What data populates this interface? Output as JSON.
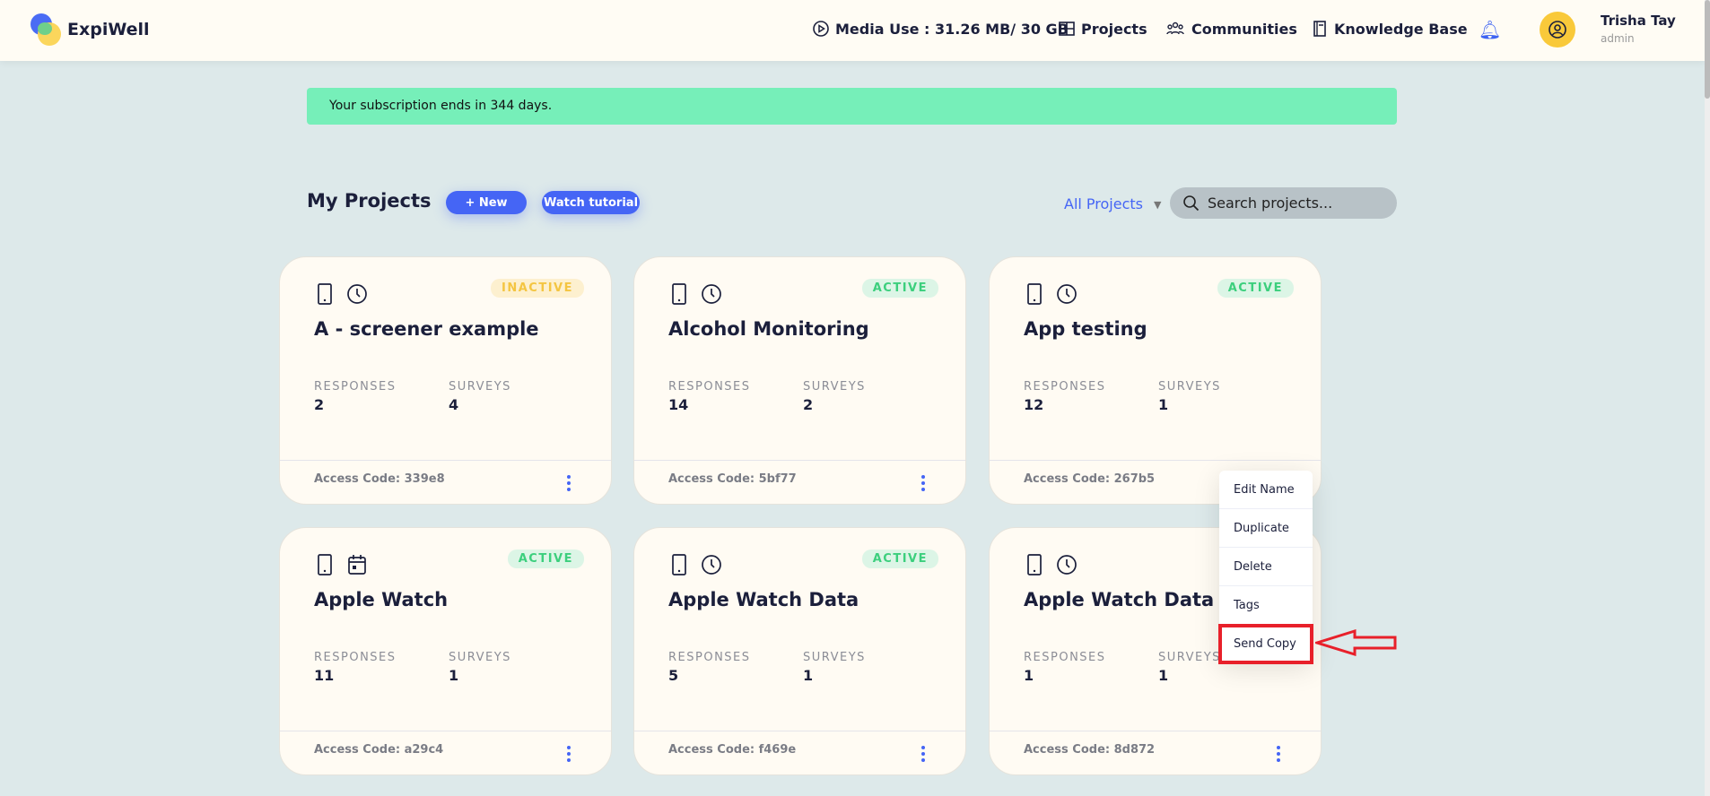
{
  "header": {
    "brand": "ExpiWell",
    "media_use": "Media Use : 31.26 MB/ 30 GB",
    "nav": [
      "Projects",
      "Communities",
      "Knowledge Base"
    ],
    "user_name": "Trisha Tay",
    "user_role": "admin"
  },
  "banner": "Your subscription ends in 344 days.",
  "toolbar": {
    "title": "My Projects",
    "new_label": "+ New",
    "tutorial_label": "Watch tutorial",
    "filter": "All Projects",
    "search_placeholder": "Search projects..."
  },
  "labels": {
    "responses": "RESPONSES",
    "surveys": "SURVEYS"
  },
  "projects": [
    {
      "name": "A - screener example",
      "status": "INACTIVE",
      "responses": "2",
      "surveys": "4",
      "access": "Access Code: 339e8",
      "icon": "clock"
    },
    {
      "name": "Alcohol Monitoring",
      "status": "ACTIVE",
      "responses": "14",
      "surveys": "2",
      "access": "Access Code: 5bf77",
      "icon": "clock"
    },
    {
      "name": "App testing",
      "status": "ACTIVE",
      "responses": "12",
      "surveys": "1",
      "access": "Access Code: 267b5",
      "icon": "clock"
    },
    {
      "name": "Apple Watch",
      "status": "ACTIVE",
      "responses": "11",
      "surveys": "1",
      "access": "Access Code: a29c4",
      "icon": "calendar"
    },
    {
      "name": "Apple Watch Data",
      "status": "ACTIVE",
      "responses": "5",
      "surveys": "1",
      "access": "Access Code: f469e",
      "icon": "clock"
    },
    {
      "name": "Apple Watch Data V2",
      "status": "",
      "responses": "1",
      "surveys": "1",
      "access": "Access Code: 8d872",
      "icon": "clock"
    }
  ],
  "context_menu": [
    "Edit Name",
    "Duplicate",
    "Delete",
    "Tags",
    "Send Copy"
  ],
  "colors": {
    "accent": "#4565f5",
    "banner": "#76efb9",
    "highlight": "#e8202a"
  }
}
